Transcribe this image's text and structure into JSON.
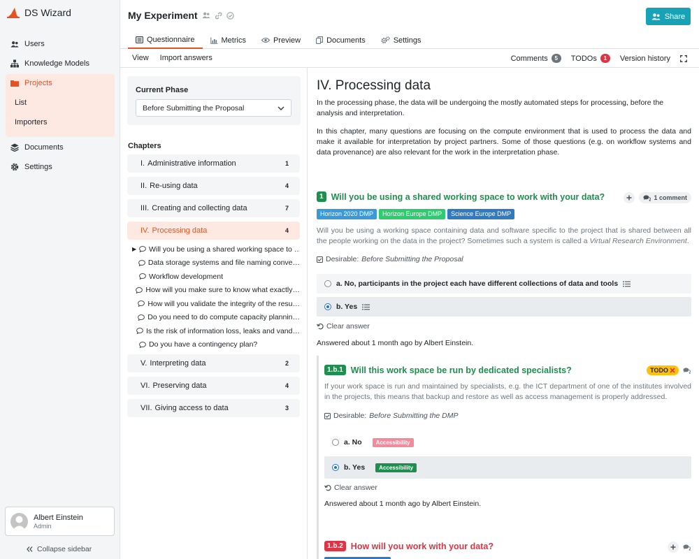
{
  "brand": {
    "name": "DS Wizard"
  },
  "sidebar": {
    "items": [
      {
        "label": "Users",
        "icon": "users-icon"
      },
      {
        "label": "Knowledge Models",
        "icon": "sitemap-icon"
      },
      {
        "label": "Projects",
        "icon": "folder-icon"
      },
      {
        "label": "Documents",
        "icon": "layers-icon"
      },
      {
        "label": "Settings",
        "icon": "gear-icon"
      }
    ],
    "projects_sub": [
      "List",
      "Importers"
    ],
    "user": {
      "name": "Albert Einstein",
      "role": "Admin"
    },
    "collapse_label": "Collapse sidebar"
  },
  "header": {
    "title": "My Experiment",
    "share_label": "Share",
    "tabs": [
      {
        "label": "Questionnaire",
        "icon": "list-icon",
        "active": true
      },
      {
        "label": "Metrics",
        "icon": "bar-chart-icon"
      },
      {
        "label": "Preview",
        "icon": "eye-icon"
      },
      {
        "label": "Documents",
        "icon": "copy-icon"
      },
      {
        "label": "Settings",
        "icon": "cogs-icon"
      }
    ]
  },
  "toolbar": {
    "view": "View",
    "import": "Import answers",
    "comments": "Comments",
    "comments_count": "5",
    "todos": "TODOs",
    "todos_count": "1",
    "history": "Version history"
  },
  "phase": {
    "label": "Current Phase",
    "selected": "Before Submitting the Proposal"
  },
  "chapters": {
    "heading": "Chapters",
    "list": [
      {
        "num": "I.",
        "title": "Administrative information",
        "count": "1"
      },
      {
        "num": "II.",
        "title": "Re-using data",
        "count": "4"
      },
      {
        "num": "III.",
        "title": "Creating and collecting data",
        "count": "7"
      },
      {
        "num": "IV.",
        "title": "Processing data",
        "count": "4"
      },
      {
        "num": "V.",
        "title": "Interpreting data",
        "count": "2"
      },
      {
        "num": "VI.",
        "title": "Preserving data",
        "count": "4"
      },
      {
        "num": "VII.",
        "title": "Giving access to data",
        "count": "3"
      }
    ],
    "questions": [
      "Will you be using a shared working space to …",
      "Data storage systems and file naming conve…",
      "Workflow development",
      "How will you make sure to know what exactly…",
      "How will you validate the integrity of the resu…",
      "Do you need to do compute capacity plannin…",
      "Is the risk of information loss, leaks and vand…",
      "Do you have a contingency plan?"
    ]
  },
  "content": {
    "title": "IV. Processing data",
    "intro1": "In the processing phase, the data will be undergoing the mostly automated steps for processing, before the analysis and interpretation.",
    "intro2": "In this chapter, many questions are focusing on the compute environment that is used to process the data and make it available for interpretation by project partners. Some of those questions (e.g. on workflow systems and data provenance) are also relevant for the work in the interpretation phase.",
    "q1": {
      "num": "1",
      "title": "Will you be using a shared working space to work with your data?",
      "comment_label": "1 comment",
      "tags": [
        {
          "label": "Horizon 2020 DMP",
          "color": "#3a9ad9"
        },
        {
          "label": "Horizon Europe DMP",
          "color": "#2ecc71"
        },
        {
          "label": "Science Europe DMP",
          "color": "#2f7bc1"
        }
      ],
      "desc_a": "Will you be using a working space containing data and software specific to the project that is shared between all the people working on the data in the project? Sometimes such a system is called a ",
      "desc_em": "Virtual Research Environment",
      "desc_b": ".",
      "desirable": "Desirable:",
      "desirable_phase": "Before Submitting the Proposal",
      "answer_a": "a. No, participants in the project each have different collections of data and tools",
      "answer_b": "b. Yes",
      "clear": "Clear answer",
      "answered": "Answered about 1 month ago by Albert Einstein."
    },
    "q1b1": {
      "num": "1.b.1",
      "title": "Will this work space be run by dedicated specialists?",
      "todo": "TODO",
      "desc": "If your work space is run and maintained by specialists, e.g. the ICT department of one of the institutes involved in the projects, this means that backup and restore as well as access management is properly addressed.",
      "desirable": "Desirable:",
      "desirable_phase": "Before Submitting the DMP",
      "answer_a": "a. No",
      "answer_b": "b. Yes",
      "tag": "Accessibility",
      "clear": "Clear answer",
      "answered": "Answered about 1 month ago by Albert Einstein."
    },
    "q1b2": {
      "num": "1.b.2",
      "title": "How will you work with your data?"
    }
  },
  "colors": {
    "accent": "#e8511f",
    "green": "#1e8f4e",
    "red": "#dc3545",
    "share": "#17a2b8"
  }
}
